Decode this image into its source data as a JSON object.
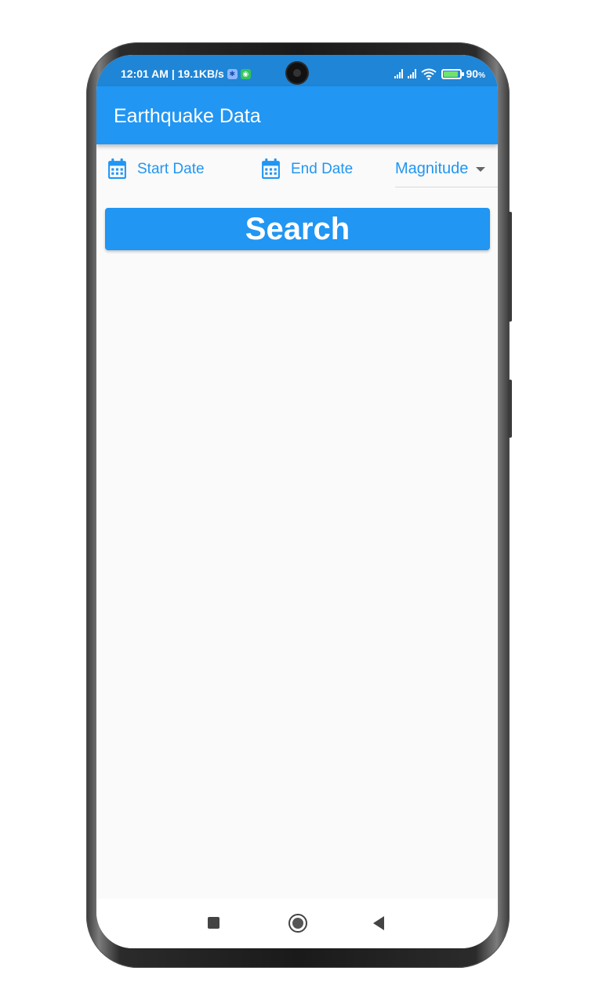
{
  "status_bar": {
    "time_info": "12:01 AM | 19.1KB/s",
    "battery_percent": "90",
    "battery_unit": "%"
  },
  "app_bar": {
    "title": "Earthquake Data"
  },
  "filters": {
    "start_date_label": "Start Date",
    "end_date_label": "End Date",
    "magnitude_label": "Magnitude"
  },
  "search_button": {
    "label": "Search"
  },
  "colors": {
    "primary": "#2196f3",
    "status_bar": "#1f85d6",
    "background": "#fafafa"
  },
  "icons": {
    "start_date": "calendar-icon",
    "end_date": "calendar-icon",
    "magnitude_dropdown": "caret-down-icon",
    "nav_recents": "square-icon",
    "nav_home": "circle-icon",
    "nav_back": "triangle-back-icon"
  }
}
